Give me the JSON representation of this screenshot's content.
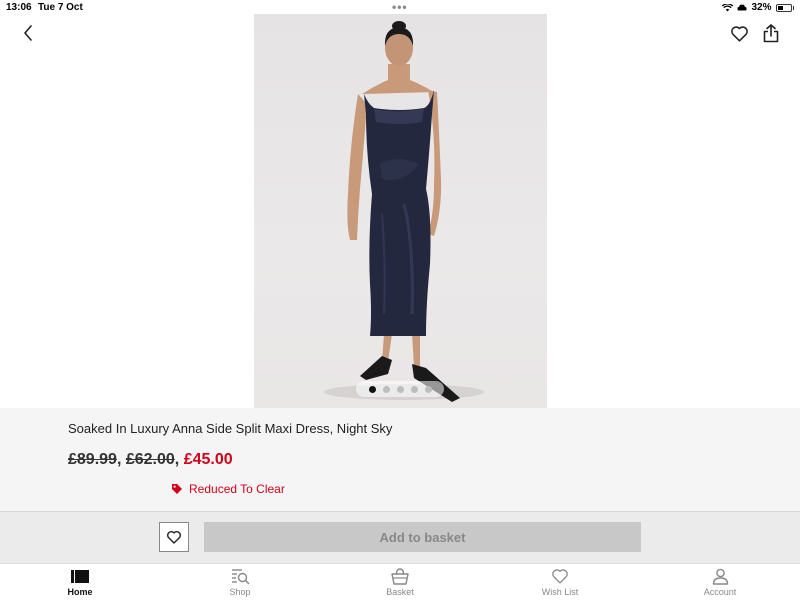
{
  "status_bar": {
    "time": "13:06",
    "date": "Tue 7 Oct",
    "battery": "32%",
    "dots": "•••"
  },
  "nav": {
    "back_icon": "chevron-left-icon",
    "wishlist_icon": "heart-icon",
    "share_icon": "share-icon"
  },
  "carousel": {
    "total": 5,
    "active": 0
  },
  "product": {
    "title": "Soaked In Luxury Anna Side Split Maxi Dress, Night Sky",
    "was_price_1": "£89.99",
    "separator": ",",
    "was_price_2": "£62.00",
    "now_price": "£45.00",
    "badge": "Reduced To Clear",
    "sale_color": "#d0021b"
  },
  "actions": {
    "add_to_basket": "Add to basket"
  },
  "tabs": [
    {
      "label": "Home",
      "icon": "home-icon",
      "active": true
    },
    {
      "label": "Shop",
      "icon": "search-list-icon",
      "active": false
    },
    {
      "label": "Basket",
      "icon": "basket-icon",
      "active": false
    },
    {
      "label": "Wish List",
      "icon": "heart-icon",
      "active": false
    },
    {
      "label": "Account",
      "icon": "person-icon",
      "active": false
    }
  ]
}
